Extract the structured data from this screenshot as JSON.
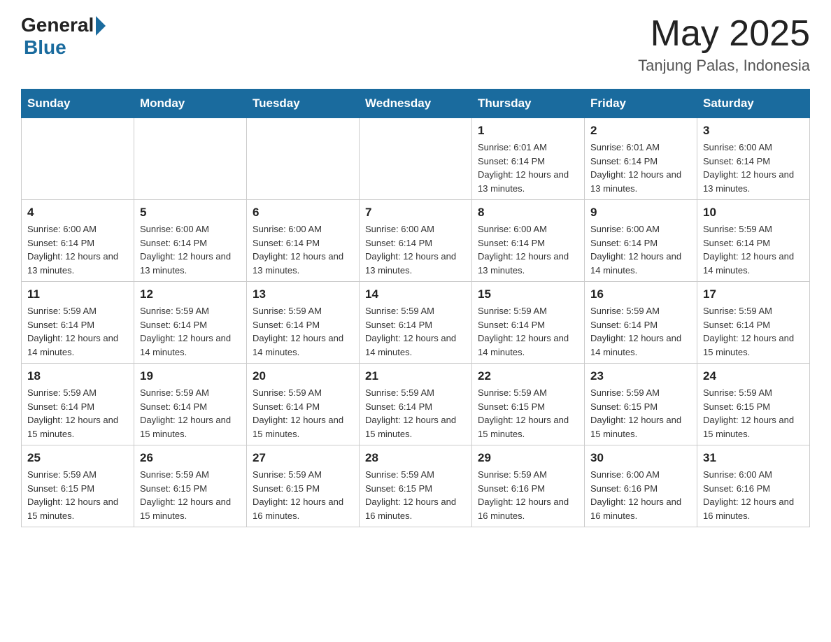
{
  "header": {
    "logo_general": "General",
    "logo_blue": "Blue",
    "month_year": "May 2025",
    "location": "Tanjung Palas, Indonesia"
  },
  "days_of_week": [
    "Sunday",
    "Monday",
    "Tuesday",
    "Wednesday",
    "Thursday",
    "Friday",
    "Saturday"
  ],
  "weeks": [
    {
      "days": [
        {
          "number": "",
          "info": ""
        },
        {
          "number": "",
          "info": ""
        },
        {
          "number": "",
          "info": ""
        },
        {
          "number": "",
          "info": ""
        },
        {
          "number": "1",
          "info": "Sunrise: 6:01 AM\nSunset: 6:14 PM\nDaylight: 12 hours and 13 minutes."
        },
        {
          "number": "2",
          "info": "Sunrise: 6:01 AM\nSunset: 6:14 PM\nDaylight: 12 hours and 13 minutes."
        },
        {
          "number": "3",
          "info": "Sunrise: 6:00 AM\nSunset: 6:14 PM\nDaylight: 12 hours and 13 minutes."
        }
      ]
    },
    {
      "days": [
        {
          "number": "4",
          "info": "Sunrise: 6:00 AM\nSunset: 6:14 PM\nDaylight: 12 hours and 13 minutes."
        },
        {
          "number": "5",
          "info": "Sunrise: 6:00 AM\nSunset: 6:14 PM\nDaylight: 12 hours and 13 minutes."
        },
        {
          "number": "6",
          "info": "Sunrise: 6:00 AM\nSunset: 6:14 PM\nDaylight: 12 hours and 13 minutes."
        },
        {
          "number": "7",
          "info": "Sunrise: 6:00 AM\nSunset: 6:14 PM\nDaylight: 12 hours and 13 minutes."
        },
        {
          "number": "8",
          "info": "Sunrise: 6:00 AM\nSunset: 6:14 PM\nDaylight: 12 hours and 13 minutes."
        },
        {
          "number": "9",
          "info": "Sunrise: 6:00 AM\nSunset: 6:14 PM\nDaylight: 12 hours and 14 minutes."
        },
        {
          "number": "10",
          "info": "Sunrise: 5:59 AM\nSunset: 6:14 PM\nDaylight: 12 hours and 14 minutes."
        }
      ]
    },
    {
      "days": [
        {
          "number": "11",
          "info": "Sunrise: 5:59 AM\nSunset: 6:14 PM\nDaylight: 12 hours and 14 minutes."
        },
        {
          "number": "12",
          "info": "Sunrise: 5:59 AM\nSunset: 6:14 PM\nDaylight: 12 hours and 14 minutes."
        },
        {
          "number": "13",
          "info": "Sunrise: 5:59 AM\nSunset: 6:14 PM\nDaylight: 12 hours and 14 minutes."
        },
        {
          "number": "14",
          "info": "Sunrise: 5:59 AM\nSunset: 6:14 PM\nDaylight: 12 hours and 14 minutes."
        },
        {
          "number": "15",
          "info": "Sunrise: 5:59 AM\nSunset: 6:14 PM\nDaylight: 12 hours and 14 minutes."
        },
        {
          "number": "16",
          "info": "Sunrise: 5:59 AM\nSunset: 6:14 PM\nDaylight: 12 hours and 14 minutes."
        },
        {
          "number": "17",
          "info": "Sunrise: 5:59 AM\nSunset: 6:14 PM\nDaylight: 12 hours and 15 minutes."
        }
      ]
    },
    {
      "days": [
        {
          "number": "18",
          "info": "Sunrise: 5:59 AM\nSunset: 6:14 PM\nDaylight: 12 hours and 15 minutes."
        },
        {
          "number": "19",
          "info": "Sunrise: 5:59 AM\nSunset: 6:14 PM\nDaylight: 12 hours and 15 minutes."
        },
        {
          "number": "20",
          "info": "Sunrise: 5:59 AM\nSunset: 6:14 PM\nDaylight: 12 hours and 15 minutes."
        },
        {
          "number": "21",
          "info": "Sunrise: 5:59 AM\nSunset: 6:14 PM\nDaylight: 12 hours and 15 minutes."
        },
        {
          "number": "22",
          "info": "Sunrise: 5:59 AM\nSunset: 6:15 PM\nDaylight: 12 hours and 15 minutes."
        },
        {
          "number": "23",
          "info": "Sunrise: 5:59 AM\nSunset: 6:15 PM\nDaylight: 12 hours and 15 minutes."
        },
        {
          "number": "24",
          "info": "Sunrise: 5:59 AM\nSunset: 6:15 PM\nDaylight: 12 hours and 15 minutes."
        }
      ]
    },
    {
      "days": [
        {
          "number": "25",
          "info": "Sunrise: 5:59 AM\nSunset: 6:15 PM\nDaylight: 12 hours and 15 minutes."
        },
        {
          "number": "26",
          "info": "Sunrise: 5:59 AM\nSunset: 6:15 PM\nDaylight: 12 hours and 15 minutes."
        },
        {
          "number": "27",
          "info": "Sunrise: 5:59 AM\nSunset: 6:15 PM\nDaylight: 12 hours and 16 minutes."
        },
        {
          "number": "28",
          "info": "Sunrise: 5:59 AM\nSunset: 6:15 PM\nDaylight: 12 hours and 16 minutes."
        },
        {
          "number": "29",
          "info": "Sunrise: 5:59 AM\nSunset: 6:16 PM\nDaylight: 12 hours and 16 minutes."
        },
        {
          "number": "30",
          "info": "Sunrise: 6:00 AM\nSunset: 6:16 PM\nDaylight: 12 hours and 16 minutes."
        },
        {
          "number": "31",
          "info": "Sunrise: 6:00 AM\nSunset: 6:16 PM\nDaylight: 12 hours and 16 minutes."
        }
      ]
    }
  ]
}
